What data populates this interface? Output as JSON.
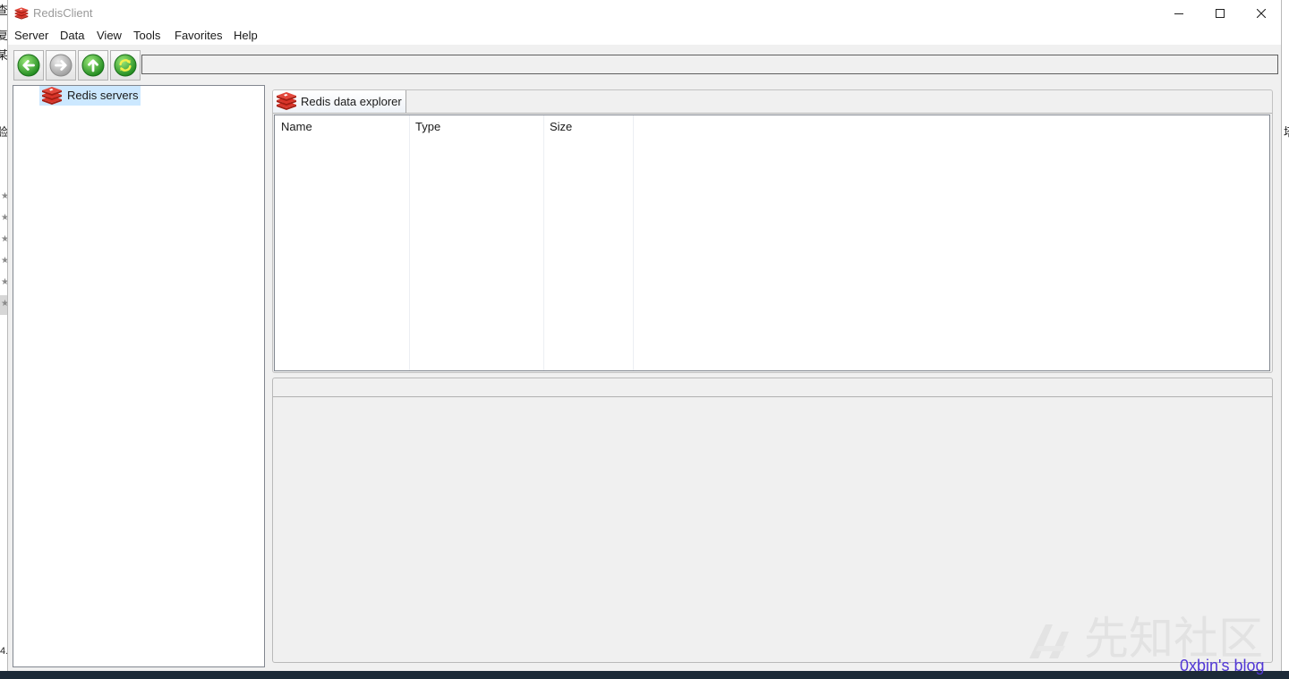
{
  "window": {
    "title": "RedisClient",
    "app_icon": "redis-icon",
    "controls": [
      "minimize-icon",
      "maximize-icon",
      "close-icon"
    ]
  },
  "menu": {
    "items": [
      {
        "label": "Server"
      },
      {
        "label": "Data"
      },
      {
        "label": "View"
      },
      {
        "label": "Tools"
      },
      {
        "label": "Favorites"
      },
      {
        "label": "Help"
      }
    ]
  },
  "toolbar": {
    "buttons": [
      {
        "icon": "back-arrow-icon",
        "enabled": true
      },
      {
        "icon": "forward-arrow-icon",
        "enabled": false
      },
      {
        "icon": "up-arrow-icon",
        "enabled": true
      },
      {
        "icon": "refresh-icon",
        "enabled": true
      }
    ],
    "address": {
      "value": ""
    }
  },
  "server_tree": {
    "items": [
      {
        "label": "Redis servers",
        "icon": "redis-icon",
        "selected": true
      }
    ]
  },
  "explorer": {
    "tab": {
      "label": "Redis data explorer",
      "icon": "redis-icon",
      "active": true
    },
    "table": {
      "columns": [
        "Name",
        "Type",
        "Size"
      ],
      "rows": []
    }
  },
  "background_window": {
    "left_edge_text": [
      "查",
      "复",
      "某",
      "验",
      "★",
      "★",
      "★",
      "★",
      "★",
      "★",
      "4."
    ],
    "right_edge_text": [
      "塔"
    ]
  },
  "watermarks": {
    "site": "先知社区",
    "blog": "0xbin's blog"
  },
  "colors": {
    "selection": "#cce8ff",
    "chrome": "#f0f0f0",
    "accent_green": "#2fa12a",
    "redis_red": "#d9352a",
    "blog_watermark": "#5137d6",
    "taskbar": "#1c2a38"
  }
}
